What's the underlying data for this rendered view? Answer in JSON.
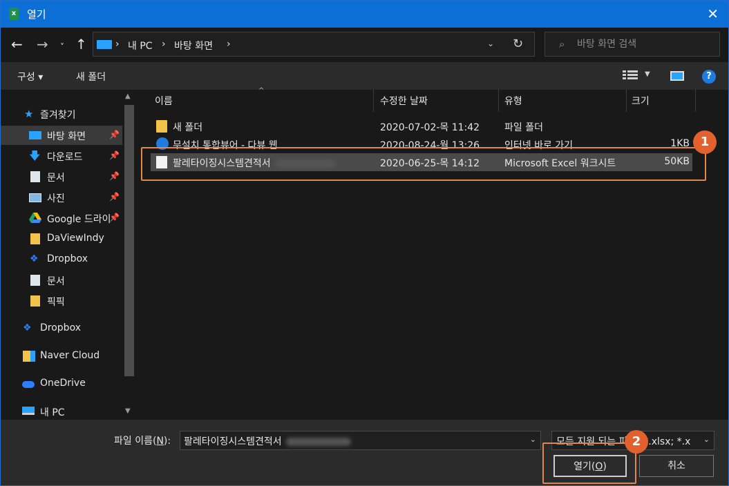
{
  "window": {
    "title": "열기",
    "app_icon_letter": "x",
    "close_glyph": "✕"
  },
  "address": {
    "back_glyph": "←",
    "forward_glyph": "→",
    "recent_glyph": "˅",
    "up_glyph": "↑",
    "crumbs": [
      "›",
      "내 PC",
      "›",
      "바탕 화면",
      "›"
    ],
    "dropdown_glyph": "⌄",
    "refresh_glyph": "↻"
  },
  "search": {
    "placeholder": "바탕 화면 검색",
    "icon_glyph": "⌕"
  },
  "toolbar": {
    "organize_label": "구성 ▾",
    "new_folder_label": "새 폴더",
    "view_dropdown_glyph": "▼",
    "help_glyph": "?"
  },
  "navpane": {
    "items": [
      {
        "label": "즐겨찾기",
        "icon": "star-icon",
        "pinned": false
      },
      {
        "label": "바탕 화면",
        "icon": "desktop-icon",
        "pinned": true
      },
      {
        "label": "다운로드",
        "icon": "download-icon",
        "pinned": true
      },
      {
        "label": "문서",
        "icon": "document-icon",
        "pinned": true
      },
      {
        "label": "사진",
        "icon": "pictures-icon",
        "pinned": true
      },
      {
        "label": "Google 드라이",
        "icon": "google-drive-icon",
        "pinned": true
      },
      {
        "label": "DaViewIndy",
        "icon": "folder-icon",
        "pinned": false
      },
      {
        "label": "Dropbox",
        "icon": "dropbox-icon",
        "pinned": false
      },
      {
        "label": "문서",
        "icon": "document-icon",
        "pinned": false
      },
      {
        "label": "픽픽",
        "icon": "folder-icon",
        "pinned": false
      },
      {
        "label": "Dropbox",
        "icon": "dropbox-icon",
        "pinned": false
      },
      {
        "label": "Naver Cloud",
        "icon": "naver-cloud-icon",
        "pinned": false
      },
      {
        "label": "OneDrive",
        "icon": "onedrive-icon",
        "pinned": false
      },
      {
        "label": "내 PC",
        "icon": "pc-icon",
        "pinned": false
      }
    ],
    "pin_glyph": "📌"
  },
  "filelist": {
    "columns": [
      "이름",
      "수정한 날짜",
      "유형",
      "크기"
    ],
    "sort_glyph": "^",
    "rows": [
      {
        "name": "새 폴더",
        "date": "2020-07-02-목 11:42",
        "type": "파일 폴더",
        "size": "",
        "icon": "folder-icon"
      },
      {
        "name": "무설치 통합뷰어 - 다뷰 웹",
        "date": "2020-08-24-월 13:26",
        "type": "인터넷 바로 가기",
        "size": "1KB",
        "icon": "internet-shortcut-icon"
      },
      {
        "name": "팔레타이징시스템견적서",
        "date": "2020-06-25-목 14:12",
        "type": "Microsoft Excel 워크시트",
        "size": "50KB",
        "icon": "excel-file-icon"
      }
    ]
  },
  "annotations": {
    "badge1": "1",
    "badge2": "2"
  },
  "bottom": {
    "filename_label_prefix": "파일 이름(",
    "filename_label_key": "N",
    "filename_label_suffix": "):",
    "filename_value": "팔레타이징시스템견적서",
    "filter_value": "모든 지원 되는 파일 (*.xlsx; *.x",
    "open_label_prefix": "열기(",
    "open_label_key": "O",
    "open_label_suffix": ")",
    "cancel_label": "취소",
    "dropdown_glyph": "⌄"
  }
}
